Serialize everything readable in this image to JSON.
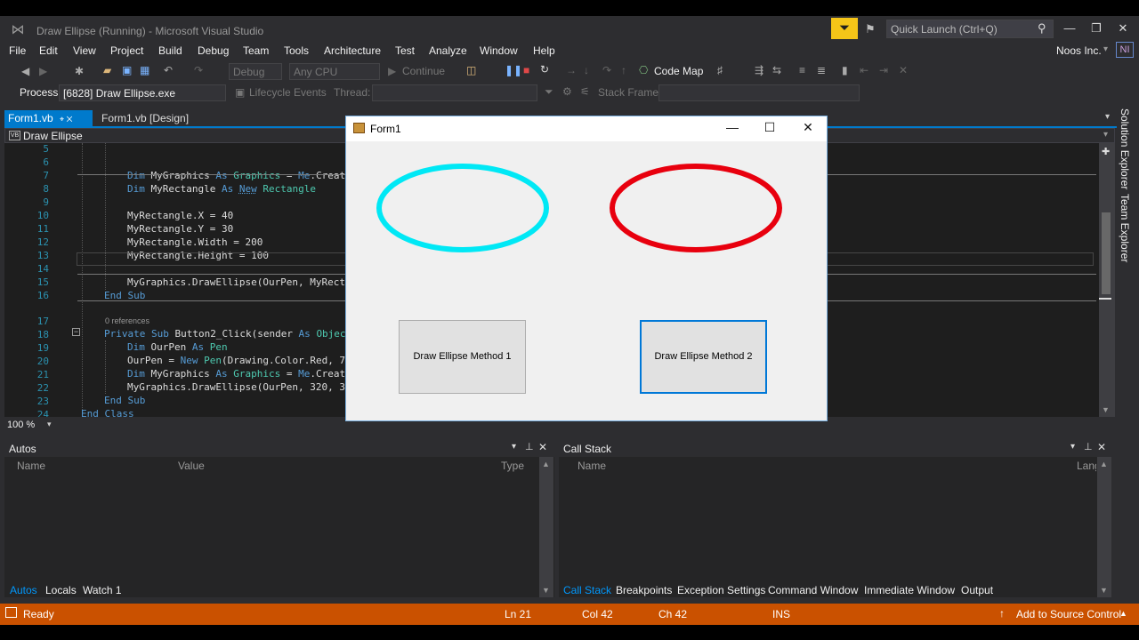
{
  "window": {
    "title": "Draw Ellipse (Running) - Microsoft Visual Studio",
    "quick_launch_placeholder": "Quick Launch (Ctrl+Q)",
    "account_name": "Noos Inc.",
    "account_initials": "NI"
  },
  "menu": [
    "File",
    "Edit",
    "View",
    "Project",
    "Build",
    "Debug",
    "Team",
    "Tools",
    "Architecture",
    "Test",
    "Analyze",
    "Window",
    "Help"
  ],
  "toolbar": {
    "config": "Debug",
    "platform": "Any CPU",
    "continue_label": "Continue",
    "codemap_label": "Code Map",
    "process_label": "Process:",
    "process_value": "[6828] Draw Ellipse.exe",
    "lifecycle_label": "Lifecycle Events",
    "thread_label": "Thread:",
    "stackframe_label": "Stack Frame:"
  },
  "tabs": {
    "active": "Form1.vb",
    "active_suffix": "⌖ ✕",
    "inactive": "Form1.vb [Design]",
    "nav_badge": "VB",
    "nav_label": "Draw Ellipse"
  },
  "editor": {
    "zoom": "100 %",
    "line_numbers": [
      "5",
      "6",
      "7",
      "8",
      "9",
      "10",
      "11",
      "12",
      "13",
      "14",
      "15",
      "16",
      "17",
      "18",
      "19",
      "20",
      "21",
      "22",
      "23",
      "24"
    ],
    "refs_label": "0 references",
    "lines": {
      "l6": [
        "Dim ",
        "MyGraphics",
        " As ",
        "Graphics",
        " = ",
        "Me",
        ".Creat"
      ],
      "l7": [
        "Dim ",
        "MyRectangle",
        " As ",
        "New",
        " ",
        "Rectangle"
      ],
      "l9": "MyRectangle.X = 40",
      "l10": "MyRectangle.Y = 30",
      "l11": "MyRectangle.Width = 200",
      "l12": "MyRectangle.Height = 100",
      "l14": "MyGraphics.DrawEllipse(OurPen, MyRect",
      "l15": "End Sub",
      "l17": [
        "Private Sub ",
        "Button2_Click(sender",
        " As ",
        "Objec"
      ],
      "l18": [
        "Dim ",
        "OurPen",
        " As ",
        "Pen"
      ],
      "l19": [
        "OurPen = ",
        "New ",
        "Pen",
        "(Drawing.Color.Red, 7"
      ],
      "l20": [
        "Dim ",
        "MyGraphics",
        " As ",
        "Graphics",
        " = ",
        "Me",
        ".Creat"
      ],
      "l21": "MyGraphics.DrawEllipse(OurPen, 320, 3",
      "l22": "End Sub",
      "l23": "End Class"
    }
  },
  "form": {
    "title": "Form1",
    "button1": "Draw Ellipse Method 1",
    "button2": "Draw Ellipse Method 2",
    "ellipse1_color": "#00e8f5",
    "ellipse2_color": "#e8000e"
  },
  "side_tabs": [
    "Solution Explorer",
    "Team Explorer"
  ],
  "autos": {
    "title": "Autos",
    "columns": [
      "Name",
      "Value",
      "Type"
    ],
    "tabs": [
      "Autos",
      "Locals",
      "Watch 1"
    ]
  },
  "callstack": {
    "title": "Call Stack",
    "columns": [
      "Name",
      "Lang"
    ],
    "tabs": [
      "Call Stack",
      "Breakpoints",
      "Exception Settings",
      "Command Window",
      "Immediate Window",
      "Output"
    ]
  },
  "status": {
    "ready": "Ready",
    "ln": "Ln 21",
    "col": "Col 42",
    "ch": "Ch 42",
    "ins": "INS",
    "source_control": "Add to Source Control"
  },
  "colors": {
    "accent": "#007acc",
    "status_bar": "#ca5100",
    "editor_bg": "#1e1e1e"
  }
}
